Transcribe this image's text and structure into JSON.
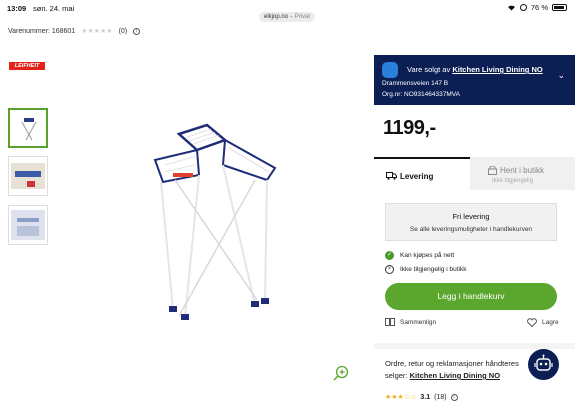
{
  "status_bar": {
    "time": "13:09",
    "date": "søn. 24. mai",
    "url": "elkjop.no",
    "private_label": "– Privat",
    "battery": "76 %"
  },
  "product": {
    "sku_label": "Varenummer: 168601",
    "stars": "★★★★★",
    "review_count": "(0)",
    "brand_logo": "LEIFHEIT"
  },
  "seller": {
    "sold_by_prefix": "Vare solgt av",
    "seller_name": "Kitchen Living Dining NO",
    "address": "Drammensveien 147 B",
    "org_nr": "Org.nr: NO931464337MVA"
  },
  "price": "1199,-",
  "tabs": {
    "delivery": "Levering",
    "pickup": "Hent i butikk",
    "pickup_sub": "Ikke tilgjengelig"
  },
  "delivery": {
    "free_title": "Fri levering",
    "free_sub": "Se alle leveringsmuligheter i handlekurven",
    "online_status": "Kan kjøpes på nett",
    "store_status": "Ikke tilgjengelig i butikk"
  },
  "cart_button": "Legg i handlekurv",
  "actions": {
    "compare": "Sammenlign",
    "save": "Lagre"
  },
  "bottom_card": {
    "line1": "Ordre, retur og reklamasjoner håndteres",
    "line2_prefix": "selger:",
    "seller_name": "Kitchen Living Dining NO",
    "rating_stars": "★★★☆☆",
    "rating_value": "3.1",
    "rating_count": "(18)"
  },
  "colors": {
    "seller_bar": "#0b1f55",
    "accent_green": "#5ba62c",
    "brand_red": "#e2231a"
  }
}
